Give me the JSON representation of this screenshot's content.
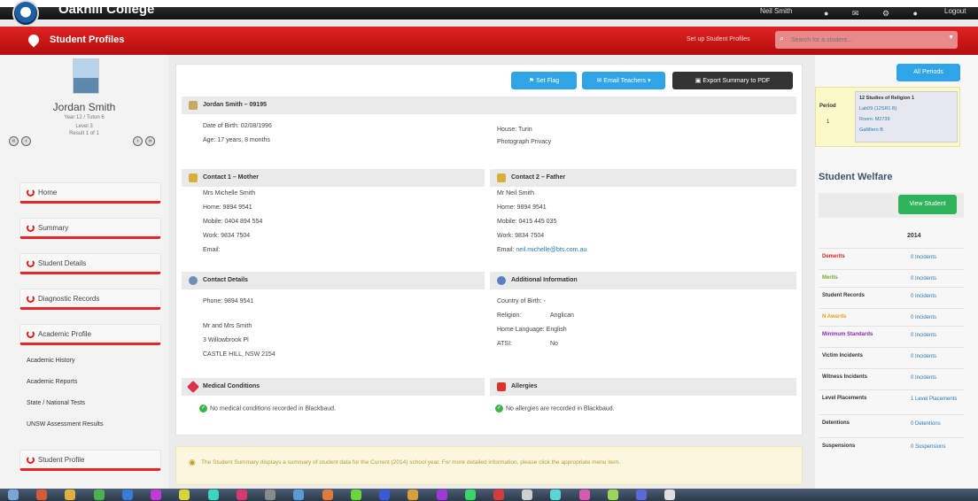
{
  "topbar": {
    "college": "Oakhill College",
    "user": "Neil Smith",
    "logout": "Logout"
  },
  "header": {
    "title": "Student Profiles",
    "setup_link": "Set up Student Profiles",
    "search_placeholder": "Search for a student..."
  },
  "student": {
    "name": "Jordan Smith",
    "year": "Year 12 / Tuton 6",
    "level": "Level 3",
    "result": "Result 1 of 1"
  },
  "nav": [
    {
      "label": "Home"
    },
    {
      "label": "Summary"
    },
    {
      "label": "Student Details"
    },
    {
      "label": "Diagnostic Records"
    },
    {
      "label": "Academic Profile"
    },
    {
      "label": "Student Profile"
    }
  ],
  "academic_links": [
    "Academic History",
    "Academic Reports",
    "State / National Tests",
    "UNSW Assessment Results"
  ],
  "toolbar": {
    "flag": "Set Flag",
    "email": "Email Teachers",
    "export": "Export Summary to PDF"
  },
  "details": {
    "header": "Jordan Smith – 09195",
    "dob": "Date of Birth: 02/08/1996",
    "age": "Age: 17 years, 8 months",
    "house": "House: Turin",
    "photo_privacy": "Photograph Privacy"
  },
  "contact1": {
    "header": "Contact 1 – Mother",
    "name": "Mrs Michelle Smith",
    "home": "Home: 9894 9541",
    "mobile": "Mobile: 0404 894 554",
    "work": "Work: 9834 7504",
    "email": "Email:"
  },
  "contact2": {
    "header": "Contact 2 – Father",
    "name": "Mr Neil Smith",
    "home": "Home: 9894 9541",
    "mobile": "Mobile: 0415 445 035",
    "work": "Work: 9834 7504",
    "email_label": "Email:",
    "email": "neil.michelle@bts.com.au"
  },
  "contact_details": {
    "header": "Contact Details",
    "phone": "Phone: 9894 9541",
    "addressee": "Mr and Mrs Smith",
    "street": "3 Willowbrook Pl",
    "suburb": "CASTLE HILL, NSW 2154"
  },
  "additional": {
    "header": "Additional Information",
    "country": "Country of Birth: -",
    "religion_label": "Religion:",
    "religion": "Anglican",
    "language": "Home Language: English",
    "atsi_label": "ATSI:",
    "atsi": "No"
  },
  "medical": {
    "header": "Medical Conditions",
    "text": "No medical conditions recorded in Blackbaud."
  },
  "allergies": {
    "header": "Allergies",
    "text": "No allergies are recorded in Blackbaud."
  },
  "notice": {
    "text": "The Student Summary displays a summary of student data for the Current (2014) school year. For more detailed information, please click the appropriate menu item."
  },
  "periods": {
    "button": "All Periods",
    "label": "Period",
    "number": "1",
    "class": "12 Studies of Religion 1",
    "room": "Lab09 (12SR1 B)",
    "teacher": "Room: M2739",
    "teacher2": "Gallifiero B"
  },
  "welfare": {
    "title": "Student Welfare",
    "view_button": "View Student",
    "year": "2014",
    "rows": [
      {
        "label": "Demerits",
        "value": "0 Incidents",
        "color": "#d9261c"
      },
      {
        "label": "Merits",
        "value": "0 Incidents",
        "color": "#6cae2e"
      },
      {
        "label": "Student Records",
        "value": "0 Incidents",
        "color": "#333333"
      },
      {
        "label": "N Awards",
        "value": "0 Incidents",
        "color": "#e8a21a"
      },
      {
        "label": "Minimum Standards",
        "value": "0 Incidents",
        "color": "#8a2bb0"
      },
      {
        "label": "Victim Incidents",
        "value": "0 Incidents",
        "color": "#333333"
      },
      {
        "label": "Witness Incidents",
        "value": "0 Incidents",
        "color": "#333333"
      },
      {
        "label": "Level Placements",
        "value": "1 Level Placements",
        "color": "#333333"
      },
      {
        "label": "Detentions",
        "value": "0 Detentions",
        "color": "#333333"
      },
      {
        "label": "Suspensions",
        "value": "0 Suspensions",
        "color": "#333333"
      }
    ]
  }
}
